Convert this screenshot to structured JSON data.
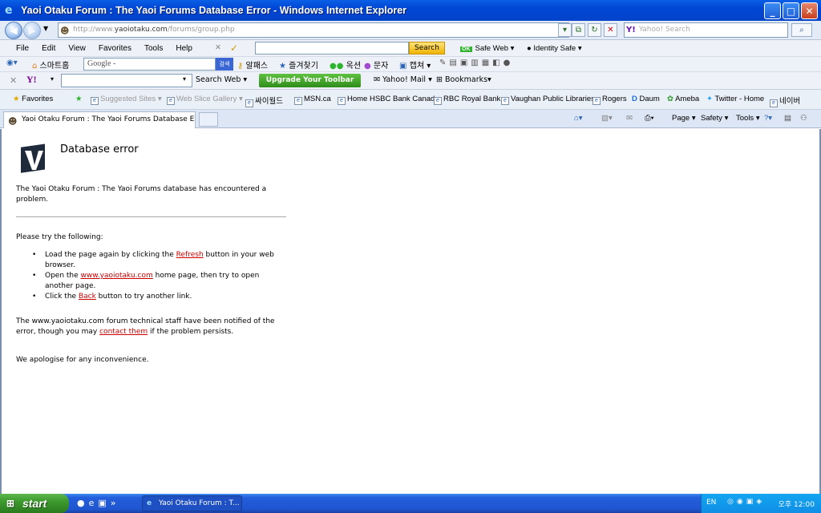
{
  "window": {
    "title": "Yaoi Otaku Forum : The Yaoi Forums Database Error - Windows Internet Explorer",
    "minimize": "_",
    "maximize": "□",
    "close": "✕"
  },
  "address_bar": {
    "prefix": "http://www.",
    "domain": "yaoiotaku.com",
    "path": "/forums/group.php",
    "search_placeholder": "Yahoo! Search"
  },
  "menu": [
    "File",
    "Edit",
    "View",
    "Favorites",
    "Tools",
    "Help"
  ],
  "toolbar1": {
    "search_button": "Search",
    "ok_badge": "OK",
    "safe_web": "Safe Web ▾",
    "identity_safe": "Identity Safe ▾"
  },
  "toolbar2": {
    "start_page": "스마트홈",
    "google_placeholder": "Google ‑",
    "google_button": "검색",
    "items": [
      "알패스",
      "즐겨찾기",
      "옥션",
      "문자",
      "캡쳐 ▾"
    ]
  },
  "toolbar3": {
    "search_web": "Search Web ▾",
    "upgrade": "Upgrade Your Toolbar Now",
    "yahoo_mail": "Yahoo! Mail ▾",
    "bookmarks": "Bookmarks▾"
  },
  "favorites": {
    "label": "Favorites",
    "items": [
      "Suggested Sites ▾",
      "Web Slice Gallery ▾",
      "싸이월드",
      "MSN.ca",
      "Home HSBC Bank Canada",
      "RBC Royal Bank",
      "Vaughan Public Libraries",
      "Rogers",
      "Daum",
      "Ameba",
      "Twitter - Home",
      "네이버"
    ]
  },
  "tab": {
    "label": "Yaoi Otaku Forum : The Yaoi Forums Database Error"
  },
  "command_bar": {
    "page": "Page ▾",
    "safety": "Safety ▾",
    "tools": "Tools ▾"
  },
  "page": {
    "title": "Database error",
    "intro": "The Yaoi Otaku Forum : The Yaoi Forums database has encountered a problem.",
    "try_heading": "Please try the following:",
    "item1_before": "Load the page again by clicking the ",
    "item1_link": "Refresh",
    "item1_after": " button in your web browser.",
    "item2_before": "Open the ",
    "item2_link": "www.yaoiotaku.com",
    "item2_after": " home page, then try to open another page.",
    "item3_before": "Click the ",
    "item3_link": "Back",
    "item3_after": " button to try another link.",
    "notify_before": "The www.yaoiotaku.com forum technical staff have been notified of the error, though you may ",
    "notify_link": "contact them",
    "notify_after": " if the problem persists.",
    "apology": "We apologise for any inconvenience."
  },
  "taskbar": {
    "start": "start",
    "window_button": "Yaoi Otaku Forum : T...",
    "lang": "EN",
    "clock": "오후 12:00"
  }
}
